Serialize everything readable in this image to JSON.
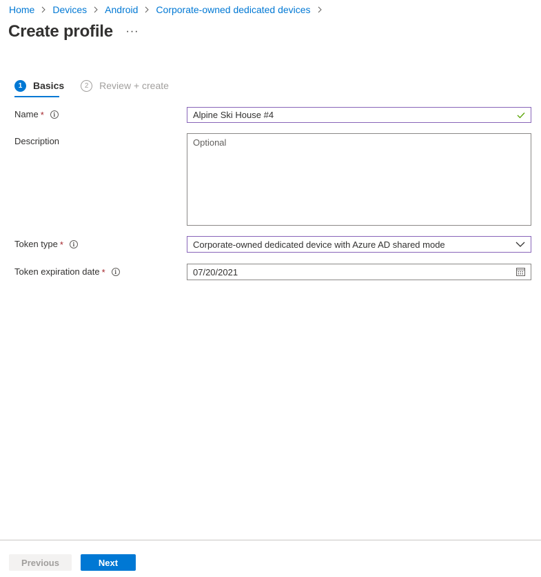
{
  "breadcrumb": {
    "items": [
      "Home",
      "Devices",
      "Android",
      "Corporate-owned dedicated devices"
    ]
  },
  "page": {
    "title": "Create profile",
    "more_label": "···"
  },
  "wizard": {
    "steps": [
      {
        "number": "1",
        "label": "Basics",
        "state": "active"
      },
      {
        "number": "2",
        "label": "Review + create",
        "state": "inactive"
      }
    ]
  },
  "form": {
    "name": {
      "label": "Name",
      "required_mark": "*",
      "value": "Alpine Ski House #4",
      "valid": true
    },
    "description": {
      "label": "Description",
      "value": "",
      "placeholder": "Optional"
    },
    "token_type": {
      "label": "Token type",
      "required_mark": "*",
      "selected": "Corporate-owned dedicated device with Azure AD shared mode"
    },
    "token_expiration_date": {
      "label": "Token expiration date",
      "required_mark": "*",
      "value": "07/20/2021"
    }
  },
  "footer": {
    "previous_label": "Previous",
    "next_label": "Next"
  },
  "colors": {
    "accent": "#0078d4",
    "required": "#a4262c",
    "focus_border": "#8764b8",
    "valid_check": "#57a300"
  },
  "icons": {
    "breadcrumb_separator": "chevron-right-icon",
    "info": "info-icon",
    "valid": "checkmark-icon",
    "dropdown": "chevron-down-icon",
    "calendar": "calendar-icon"
  }
}
